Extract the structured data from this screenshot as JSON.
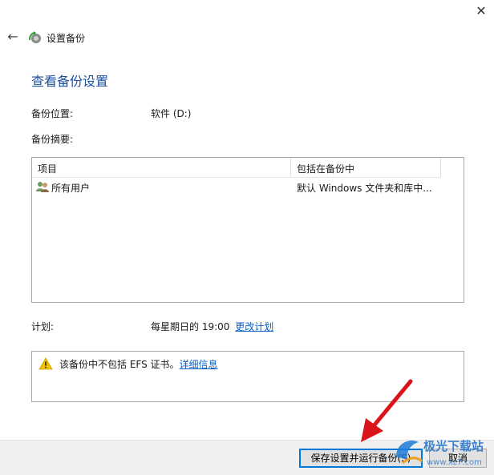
{
  "window": {
    "close_glyph": "✕",
    "back_glyph": "←",
    "title": "设置备份"
  },
  "page": {
    "heading": "查看备份设置"
  },
  "location": {
    "label": "备份位置:",
    "value": "软件 (D:)"
  },
  "summary": {
    "label": "备份摘要:",
    "columns": [
      "项目",
      "包括在备份中"
    ],
    "rows": [
      {
        "item": "所有用户",
        "included": "默认 Windows 文件夹和库中..."
      }
    ]
  },
  "schedule": {
    "label": "计划:",
    "value": "每星期日的 19:00",
    "change_link": "更改计划"
  },
  "warning": {
    "text": "该备份中不包括 EFS 证书。",
    "link": "详细信息"
  },
  "footer": {
    "save_run_label": "保存设置并运行备份(S)",
    "cancel_label": "取消"
  },
  "watermark": {
    "text": "极光下载站",
    "url": "www.xz7.com"
  },
  "colors": {
    "heading": "#1f4fa0",
    "link": "#0a5fc8",
    "annotation_arrow": "#d9141b",
    "warning": "#f2c200"
  }
}
